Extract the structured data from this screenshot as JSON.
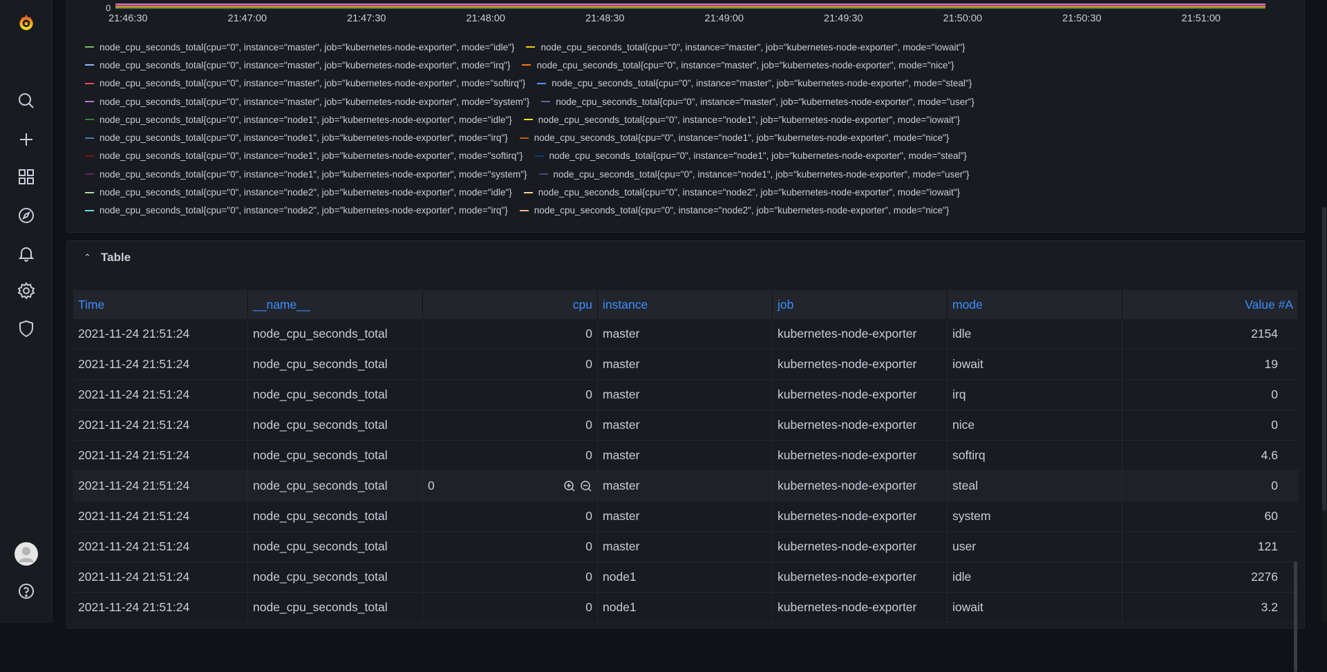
{
  "sidebar": {
    "items": [
      {
        "name": "grafana-logo",
        "icon": "grafana-logo"
      },
      {
        "name": "search",
        "icon": "search-icon"
      },
      {
        "name": "create",
        "icon": "plus-icon"
      },
      {
        "name": "dashboards",
        "icon": "grid-icon"
      },
      {
        "name": "explore",
        "icon": "compass-icon"
      },
      {
        "name": "alerting",
        "icon": "bell-icon"
      },
      {
        "name": "configuration",
        "icon": "gear-icon"
      },
      {
        "name": "server-admin",
        "icon": "shield-icon"
      },
      {
        "name": "profile",
        "icon": "avatar"
      },
      {
        "name": "help",
        "icon": "question-icon"
      }
    ]
  },
  "graph": {
    "y_zero_label": "0",
    "x_ticks": [
      "21:46:30",
      "21:47:00",
      "21:47:30",
      "21:48:00",
      "21:48:30",
      "21:49:00",
      "21:49:30",
      "21:50:00",
      "21:50:30",
      "21:51:00"
    ],
    "legend": [
      [
        {
          "label": "node_cpu_seconds_total{cpu=\"0\", instance=\"master\", job=\"kubernetes-node-exporter\", mode=\"idle\"}",
          "color": "#73bf69"
        },
        {
          "label": "node_cpu_seconds_total{cpu=\"0\", instance=\"master\", job=\"kubernetes-node-exporter\", mode=\"iowait\"}",
          "color": "#f2cc0c"
        }
      ],
      [
        {
          "label": "node_cpu_seconds_total{cpu=\"0\", instance=\"master\", job=\"kubernetes-node-exporter\", mode=\"irq\"}",
          "color": "#8ab8ff"
        },
        {
          "label": "node_cpu_seconds_total{cpu=\"0\", instance=\"master\", job=\"kubernetes-node-exporter\", mode=\"nice\"}",
          "color": "#ff780a"
        }
      ],
      [
        {
          "label": "node_cpu_seconds_total{cpu=\"0\", instance=\"master\", job=\"kubernetes-node-exporter\", mode=\"softirq\"}",
          "color": "#f2495c"
        },
        {
          "label": "node_cpu_seconds_total{cpu=\"0\", instance=\"master\", job=\"kubernetes-node-exporter\", mode=\"steal\"}",
          "color": "#5794f2"
        }
      ],
      [
        {
          "label": "node_cpu_seconds_total{cpu=\"0\", instance=\"master\", job=\"kubernetes-node-exporter\", mode=\"system\"}",
          "color": "#b877d9"
        },
        {
          "label": "node_cpu_seconds_total{cpu=\"0\", instance=\"master\", job=\"kubernetes-node-exporter\", mode=\"user\"}",
          "color": "#705da0"
        }
      ],
      [
        {
          "label": "node_cpu_seconds_total{cpu=\"0\", instance=\"node1\", job=\"kubernetes-node-exporter\", mode=\"idle\"}",
          "color": "#37872d"
        },
        {
          "label": "node_cpu_seconds_total{cpu=\"0\", instance=\"node1\", job=\"kubernetes-node-exporter\", mode=\"iowait\"}",
          "color": "#fade2a"
        }
      ],
      [
        {
          "label": "node_cpu_seconds_total{cpu=\"0\", instance=\"node1\", job=\"kubernetes-node-exporter\", mode=\"irq\"}",
          "color": "#447ebc"
        },
        {
          "label": "node_cpu_seconds_total{cpu=\"0\", instance=\"node1\", job=\"kubernetes-node-exporter\", mode=\"nice\"}",
          "color": "#c15c17"
        }
      ],
      [
        {
          "label": "node_cpu_seconds_total{cpu=\"0\", instance=\"node1\", job=\"kubernetes-node-exporter\", mode=\"softirq\"}",
          "color": "#890f02"
        },
        {
          "label": "node_cpu_seconds_total{cpu=\"0\", instance=\"node1\", job=\"kubernetes-node-exporter\", mode=\"steal\"}",
          "color": "#0a437c"
        }
      ],
      [
        {
          "label": "node_cpu_seconds_total{cpu=\"0\", instance=\"node1\", job=\"kubernetes-node-exporter\", mode=\"system\"}",
          "color": "#6d1f62"
        },
        {
          "label": "node_cpu_seconds_total{cpu=\"0\", instance=\"node1\", job=\"kubernetes-node-exporter\", mode=\"user\"}",
          "color": "#584477"
        }
      ],
      [
        {
          "label": "node_cpu_seconds_total{cpu=\"0\", instance=\"node2\", job=\"kubernetes-node-exporter\", mode=\"idle\"}",
          "color": "#b7dbab"
        },
        {
          "label": "node_cpu_seconds_total{cpu=\"0\", instance=\"node2\", job=\"kubernetes-node-exporter\", mode=\"iowait\"}",
          "color": "#f4d598"
        }
      ],
      [
        {
          "label": "node_cpu_seconds_total{cpu=\"0\", instance=\"node2\", job=\"kubernetes-node-exporter\", mode=\"irq\"}",
          "color": "#70dbed"
        },
        {
          "label": "node_cpu_seconds_total{cpu=\"0\", instance=\"node2\", job=\"kubernetes-node-exporter\", mode=\"nice\"}",
          "color": "#f9ba8f"
        }
      ]
    ]
  },
  "table": {
    "title": "Table",
    "columns": [
      "Time",
      "__name__",
      "cpu",
      "instance",
      "job",
      "mode",
      "Value #A"
    ],
    "rows": [
      [
        "2021-11-24 21:51:24",
        "node_cpu_seconds_total",
        "0",
        "master",
        "kubernetes-node-exporter",
        "idle",
        "2154"
      ],
      [
        "2021-11-24 21:51:24",
        "node_cpu_seconds_total",
        "0",
        "master",
        "kubernetes-node-exporter",
        "iowait",
        "19"
      ],
      [
        "2021-11-24 21:51:24",
        "node_cpu_seconds_total",
        "0",
        "master",
        "kubernetes-node-exporter",
        "irq",
        "0"
      ],
      [
        "2021-11-24 21:51:24",
        "node_cpu_seconds_total",
        "0",
        "master",
        "kubernetes-node-exporter",
        "nice",
        "0"
      ],
      [
        "2021-11-24 21:51:24",
        "node_cpu_seconds_total",
        "0",
        "master",
        "kubernetes-node-exporter",
        "softirq",
        "4.6"
      ],
      [
        "2021-11-24 21:51:24",
        "node_cpu_seconds_total",
        "0",
        "master",
        "kubernetes-node-exporter",
        "steal",
        "0"
      ],
      [
        "2021-11-24 21:51:24",
        "node_cpu_seconds_total",
        "0",
        "master",
        "kubernetes-node-exporter",
        "system",
        "60"
      ],
      [
        "2021-11-24 21:51:24",
        "node_cpu_seconds_total",
        "0",
        "master",
        "kubernetes-node-exporter",
        "user",
        "121"
      ],
      [
        "2021-11-24 21:51:24",
        "node_cpu_seconds_total",
        "0",
        "node1",
        "kubernetes-node-exporter",
        "idle",
        "2276"
      ],
      [
        "2021-11-24 21:51:24",
        "node_cpu_seconds_total",
        "0",
        "node1",
        "kubernetes-node-exporter",
        "iowait",
        "3.2"
      ]
    ],
    "hover_row": 5
  },
  "colors": {
    "accent": "#3d8eff",
    "background": "#111217",
    "panel": "#181b1f"
  }
}
